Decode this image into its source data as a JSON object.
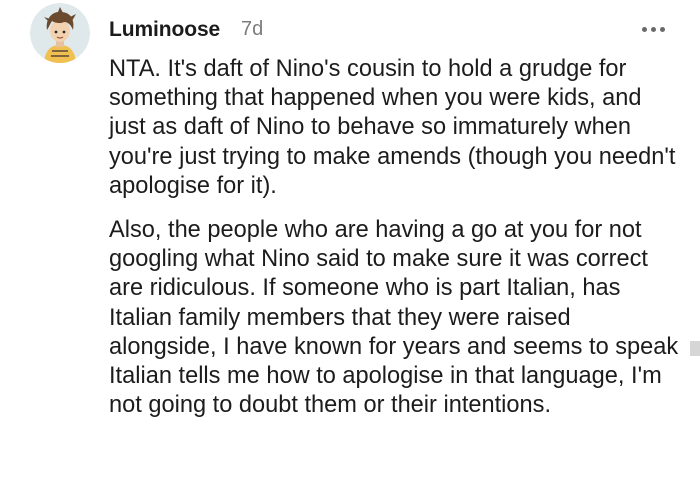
{
  "comment": {
    "author": "Luminoose",
    "age": "7d",
    "avatar_icon": "cartoon-character-avatar",
    "more_icon": "ellipsis-horizontal-icon",
    "paragraphs": [
      "NTA. It's daft of Nino's cousin to hold a grudge for something that happened when you were kids, and just as daft of Nino to behave so immaturely when you're just trying to make amends (though you needn't apologise for it).",
      "Also, the people who are having a go at you for not googling what Nino said to make sure it was correct are ridiculous. If someone who is part Italian, has Italian family members that they were raised alongside, I have known for years and seems to speak Italian tells me how to apologise in that language, I'm not going to doubt them or their intentions."
    ]
  },
  "colors": {
    "text": "#1c1c1c",
    "meta": "#7c7c7c",
    "avatar_bg": "#dfe8ea"
  }
}
